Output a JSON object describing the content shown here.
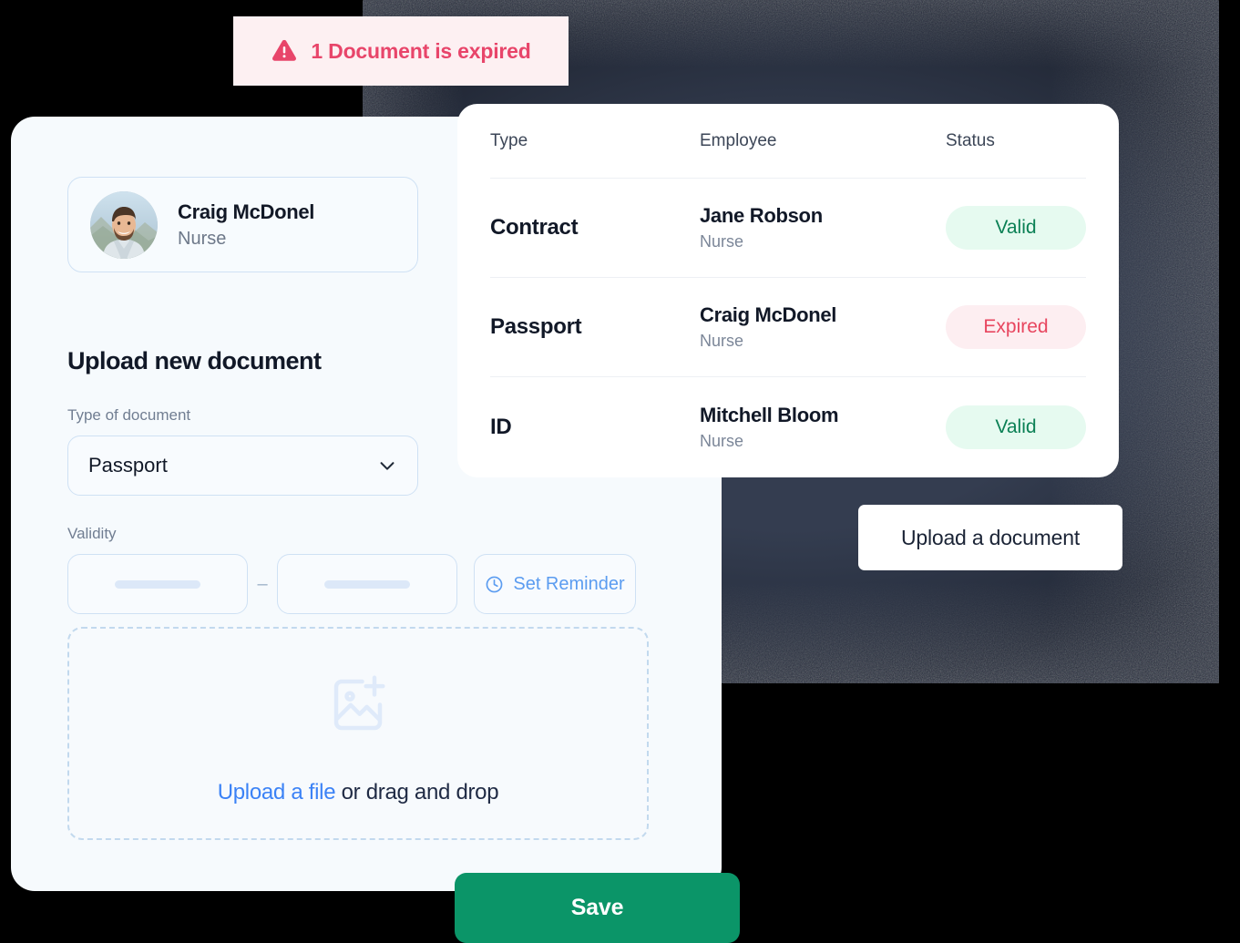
{
  "alert": {
    "icon": "warning-triangle-icon",
    "message": "1 Document is expired",
    "bg_color": "#fdf0f2",
    "text_color": "#e8456a"
  },
  "form_panel": {
    "profile": {
      "name": "Craig McDonel",
      "role": "Nurse",
      "avatar_alt": "employee-avatar"
    },
    "section_title": "Upload new document",
    "type_field": {
      "label": "Type of document",
      "value": "Passport",
      "chevron": "chevron-down-icon"
    },
    "validity_field": {
      "label": "Validity",
      "start_value": "",
      "end_value": "",
      "separator": "–",
      "reminder_label": "Set Reminder",
      "reminder_icon": "clock-icon"
    },
    "dropzone": {
      "icon": "image-plus-icon",
      "link_text": "Upload a file",
      "rest_text": " or drag and drop"
    },
    "save_label": "Save",
    "save_color": "#0b9568"
  },
  "table_card": {
    "columns": [
      "Type",
      "Employee",
      "Status"
    ],
    "rows": [
      {
        "type": "Contract",
        "employee": "Jane Robson",
        "role": "Nurse",
        "status": "Valid",
        "status_kind": "valid"
      },
      {
        "type": "Passport",
        "employee": "Craig McDonel",
        "role": "Nurse",
        "status": "Expired",
        "status_kind": "expired"
      },
      {
        "type": "ID",
        "employee": "Mitchell Bloom",
        "role": "Nurse",
        "status": "Valid",
        "status_kind": "valid"
      }
    ],
    "status_colors": {
      "valid_bg": "#e6faf0",
      "valid_fg": "#0b8055",
      "expired_bg": "#fdeef1",
      "expired_fg": "#e8465f"
    }
  },
  "upload_document_button": {
    "label": "Upload a document"
  },
  "backdrop": {
    "color": "#343d50"
  }
}
